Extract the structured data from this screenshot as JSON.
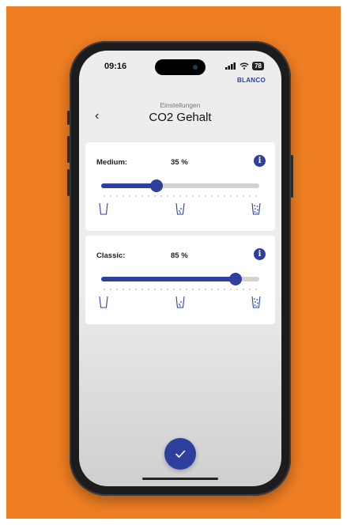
{
  "status_bar": {
    "time": "09:16",
    "battery": "78"
  },
  "brand": "BLANCO",
  "header": {
    "back_icon": "‹",
    "subtitle": "Einstellungen",
    "title": "CO2 Gehalt"
  },
  "settings": [
    {
      "label": "Medium:",
      "value_text": "35 %",
      "level": 0.35,
      "info_icon": "i"
    },
    {
      "label": "Classic:",
      "value_text": "85 %",
      "level": 0.85,
      "info_icon": "i"
    }
  ],
  "glass_icons": [
    "glass-empty-icon",
    "glass-some-bubbles-icon",
    "glass-many-bubbles-icon"
  ],
  "icons": {
    "confirm": "checkmark-icon"
  },
  "colors": {
    "background": "#f07f23",
    "accent": "#2e3f9e"
  }
}
